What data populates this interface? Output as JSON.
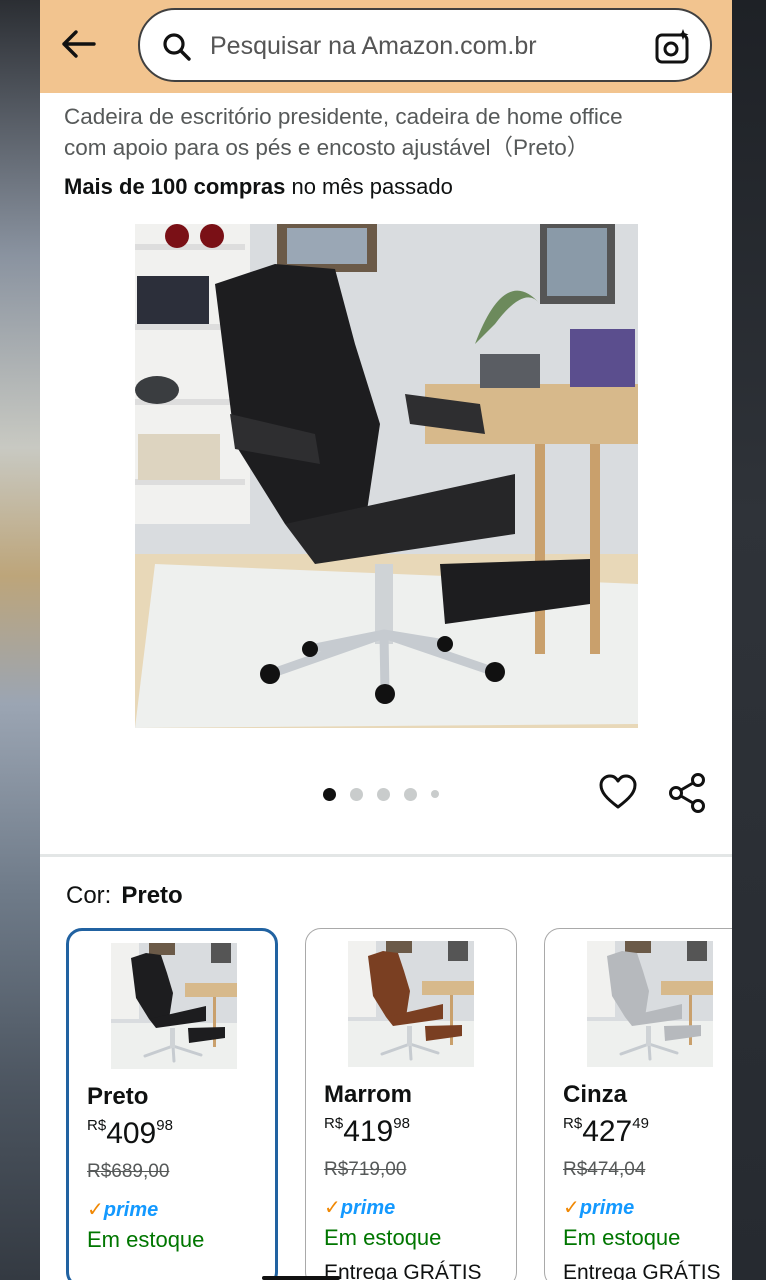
{
  "header": {
    "search_placeholder": "Pesquisar na Amazon.com.br",
    "background_color": "#f2c48f"
  },
  "product": {
    "title_line1": "Cadeira de escritório presidente, cadeira de home office",
    "title_line2": "com apoio para os pés e encosto ajustável（Preto）",
    "purchases_bold": "Mais de 100 compras",
    "purchases_rest": " no mês passado"
  },
  "gallery": {
    "image_count": 5,
    "active_index": 0
  },
  "color_selector": {
    "label": "Cor:",
    "selected": "Preto"
  },
  "variants": [
    {
      "name": "Preto",
      "currency": "R$",
      "price_whole": "409",
      "price_cents": "98",
      "list_price": "R$689,00",
      "prime": "prime",
      "stock": "Em estoque",
      "delivery": "",
      "chair_color": "#1d1d1f"
    },
    {
      "name": "Marrom",
      "currency": "R$",
      "price_whole": "419",
      "price_cents": "98",
      "list_price": "R$719,00",
      "prime": "prime",
      "stock": "Em estoque",
      "delivery": "Entrega GRÁTIS",
      "chair_color": "#7a3f22"
    },
    {
      "name": "Cinza",
      "currency": "R$",
      "price_whole": "427",
      "price_cents": "49",
      "list_price": "R$474,04",
      "prime": "prime",
      "stock": "Em estoque",
      "delivery": "Entrega GRÁTIS",
      "chair_color": "#b6b9bd"
    }
  ],
  "colors": {
    "accent_selected_border": "#2162a1",
    "prime_blue": "#1399ff",
    "prime_check": "#f08804",
    "in_stock_green": "#007600"
  }
}
